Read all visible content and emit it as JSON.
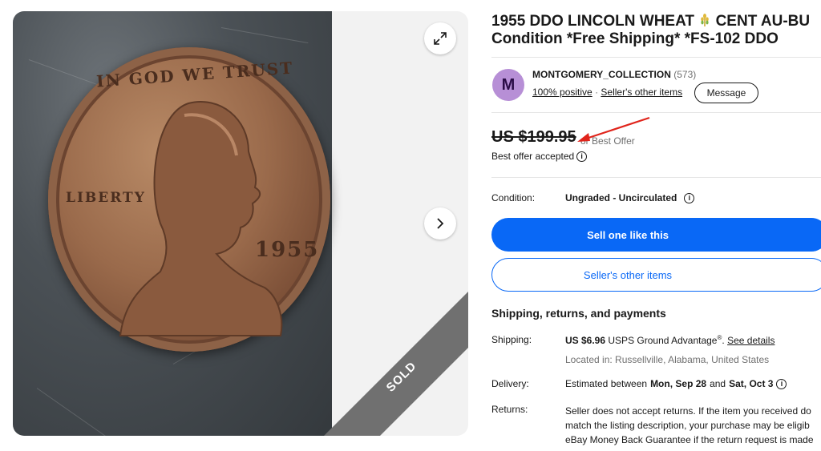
{
  "listing": {
    "title_line1": "1955 DDO LINCOLN WHEAT",
    "title_line1_tail": "CENT AU-BU",
    "title_line2": "Condition *Free Shipping* *FS-102 DDO"
  },
  "gallery": {
    "expand_icon": "expand-icon",
    "next_icon": "chevron-right-icon",
    "sold_label": "SOLD",
    "coin_text_motto": "IN GOD WE TRUST",
    "coin_text_liberty": "LIBERTY",
    "coin_text_year": "1955"
  },
  "seller": {
    "avatar_letter": "M",
    "name": "MONTGOMERY_COLLECTION",
    "feedback_count": "(573)",
    "positive": "100% positive",
    "separator": "·",
    "other_items": "Seller's other items",
    "message_label": "Message"
  },
  "pricing": {
    "price": "US $199.95",
    "or_best_offer": "or Best Offer",
    "best_offer_accepted": "Best offer accepted"
  },
  "condition": {
    "label": "Condition:",
    "value": "Ungraded - Uncirculated"
  },
  "actions": {
    "sell_one": "Sell one like this",
    "sellers_other_items": "Seller's other items"
  },
  "shipping_section": {
    "title": "Shipping, returns, and payments",
    "shipping_label": "Shipping:",
    "shipping_price": "US $6.96",
    "shipping_service": "USPS Ground Advantage",
    "shipping_reg": "®",
    "shipping_sep": ".",
    "see_details": "See details",
    "location": "Located in: Russellville, Alabama, United States",
    "delivery_label": "Delivery:",
    "delivery_prefix": "Estimated between",
    "delivery_start": "Mon, Sep 28",
    "delivery_and": "and",
    "delivery_end": "Sat, Oct 3",
    "returns_label": "Returns:",
    "returns_line1": "Seller does not accept returns. If the item you received do",
    "returns_line2": "match the listing description, your purchase may be eligib",
    "returns_line3": "eBay Money Back Guarantee if the return request is made"
  },
  "colors": {
    "primary_blue": "#0968f6",
    "avatar_purple": "#b78fd6",
    "sold_ribbon": "#707070",
    "annotation_arrow": "#e0241b"
  }
}
